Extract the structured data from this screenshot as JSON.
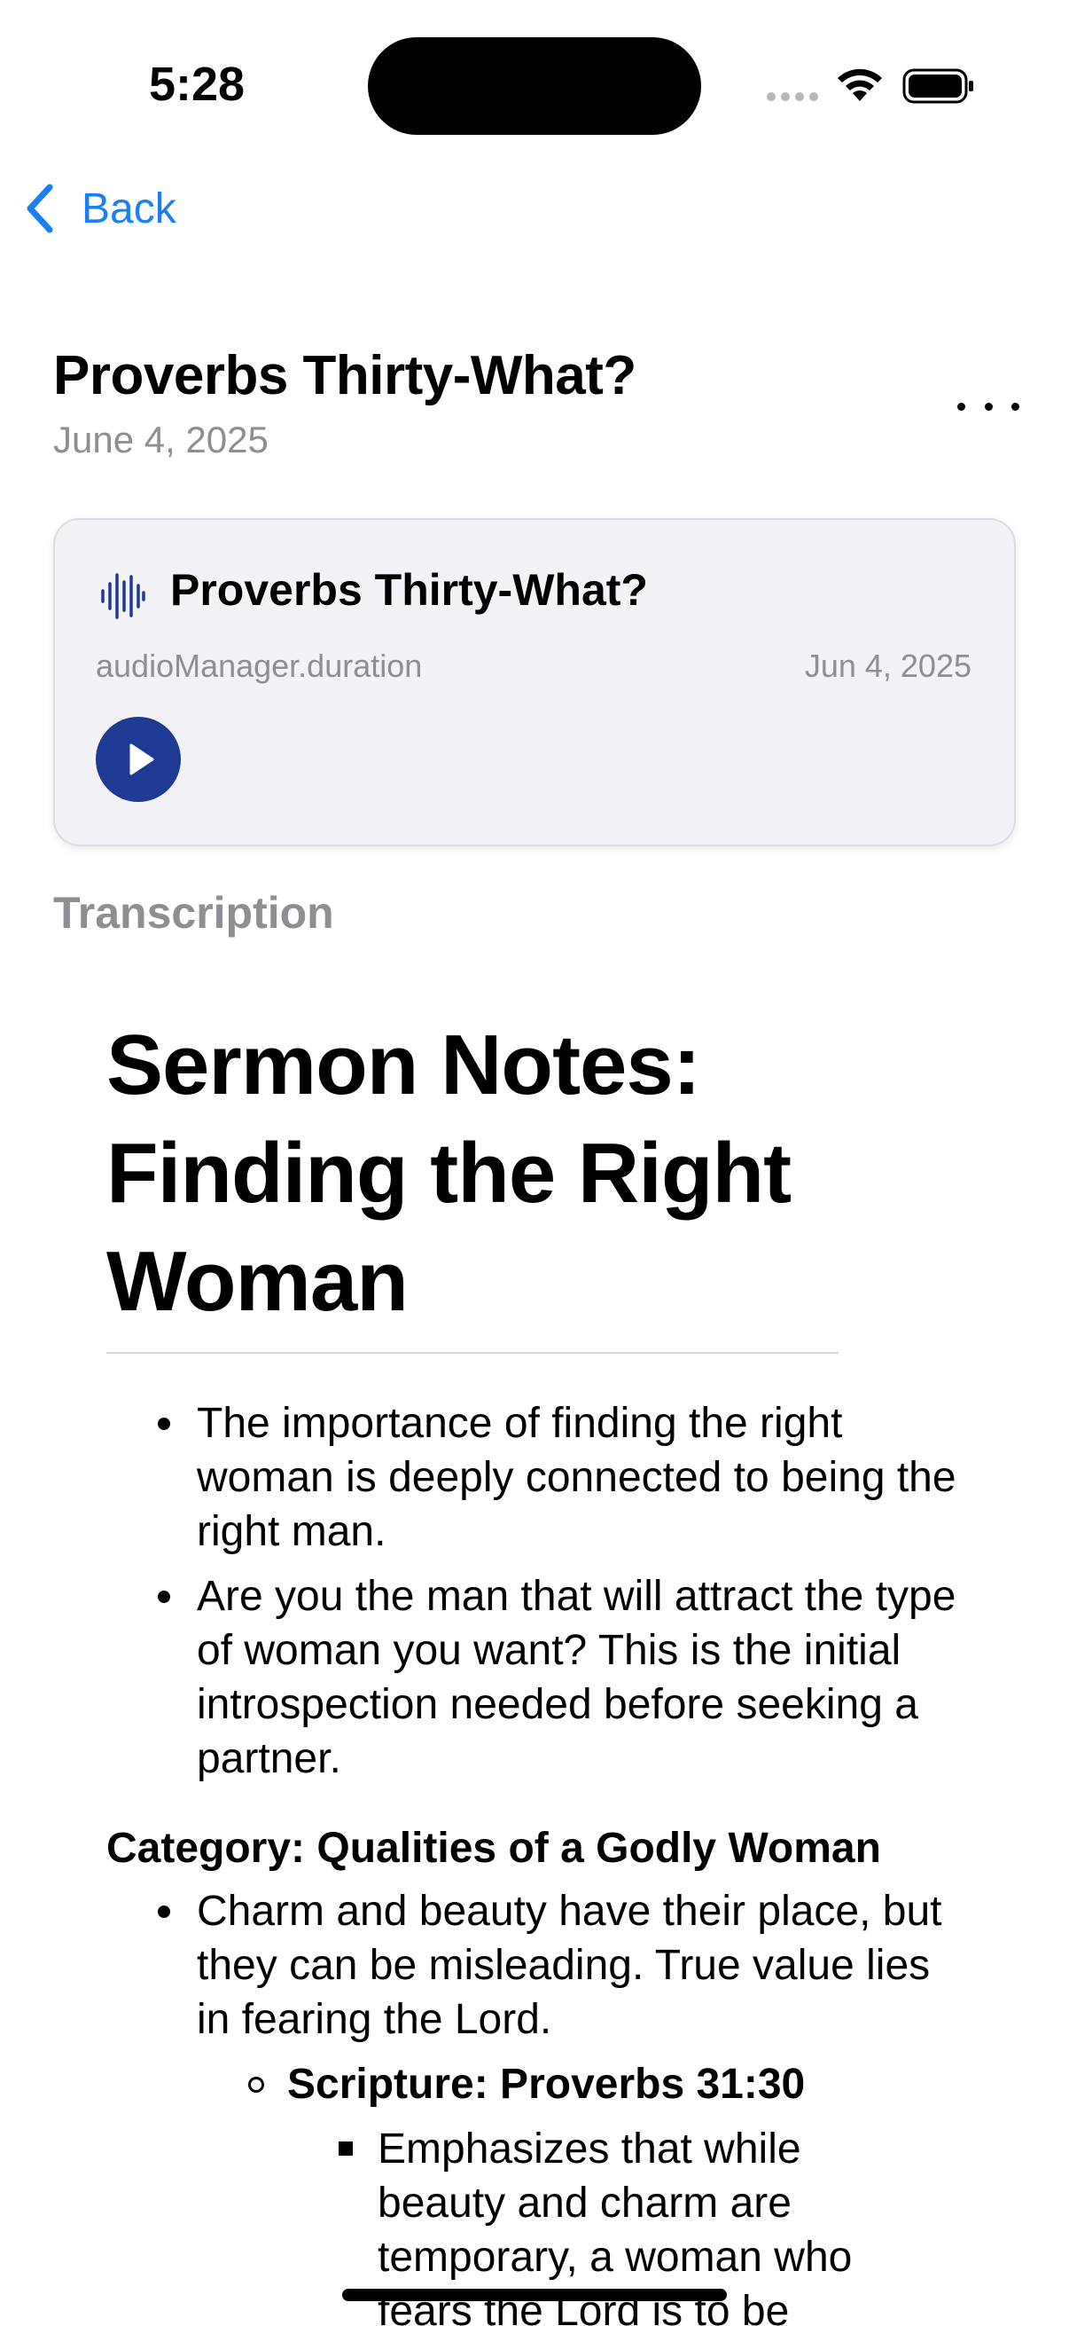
{
  "status_bar": {
    "time": "5:28",
    "icons": [
      "signal-dots-icon",
      "wifi-icon",
      "battery-icon"
    ]
  },
  "nav": {
    "back_label": "Back",
    "back_icon": "chevron-left-icon",
    "accent_color": "#1a7ff2"
  },
  "header": {
    "title": "Proverbs Thirty-What?",
    "date": "June 4, 2025",
    "more_icon": "ellipsis-icon"
  },
  "audio_card": {
    "icon": "waveform-icon",
    "title": "Proverbs Thirty-What?",
    "duration": "audioManager.duration",
    "date": "Jun 4, 2025",
    "play_icon": "play-icon",
    "play_color": "#1f3a93"
  },
  "transcription": {
    "label": "Transcription",
    "heading": "Sermon Notes: Finding the Right Woman",
    "bullets": [
      "The importance of finding the right woman is deeply connected to being the right man.",
      "Are you the man that will attract the type of woman you want? This is the initial introspection needed before seeking a partner."
    ],
    "category": "Category: Qualities of a Godly Woman",
    "category_bullets": [
      "Charm and beauty have their place, but they can be misleading. True value lies in fearing the Lord."
    ],
    "scripture": "Scripture: Proverbs 31:30",
    "scripture_points": [
      "Emphasizes that while beauty and charm are temporary, a woman who fears the Lord is to be"
    ]
  }
}
